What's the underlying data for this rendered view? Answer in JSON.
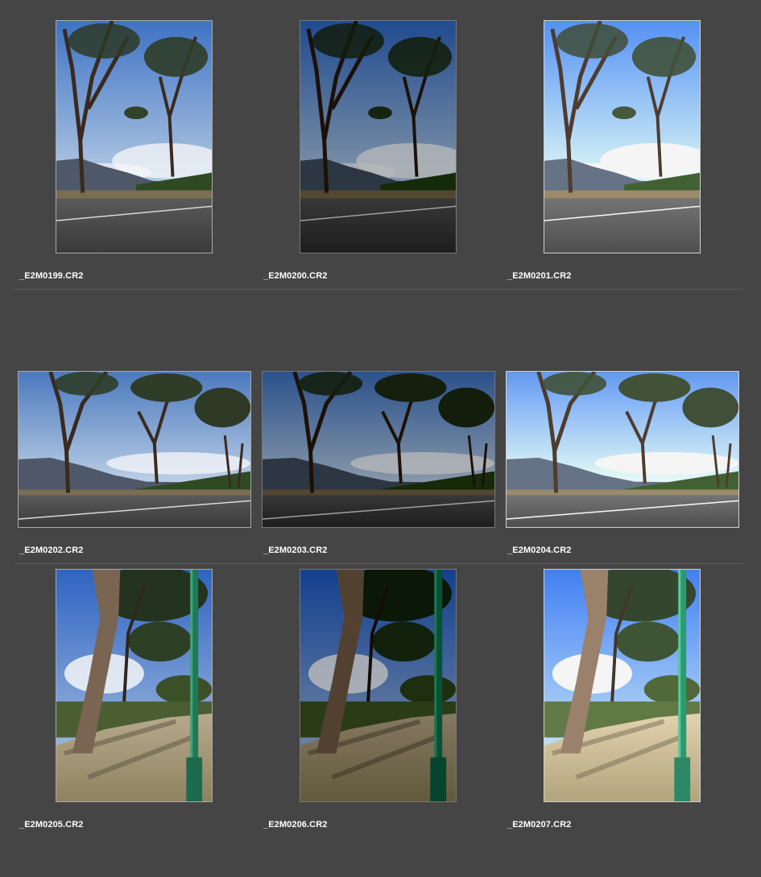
{
  "browser": {
    "rows": [
      {
        "items": [
          {
            "filename": "_E2M0199.CR2"
          },
          {
            "filename": "_E2M0200.CR2"
          },
          {
            "filename": "_E2M0201.CR2"
          }
        ]
      },
      {
        "items": [
          {
            "filename": "_E2M0202.CR2"
          },
          {
            "filename": "_E2M0203.CR2"
          },
          {
            "filename": "_E2M0204.CR2"
          }
        ]
      },
      {
        "items": [
          {
            "filename": "_E2M0205.CR2"
          },
          {
            "filename": "_E2M0206.CR2"
          },
          {
            "filename": "_E2M0207.CR2"
          }
        ]
      }
    ],
    "colors": {
      "background": "#454545",
      "thumb_border": "#a8a8a8",
      "divider": "#5e5e5e",
      "label": "#ffffff"
    }
  }
}
